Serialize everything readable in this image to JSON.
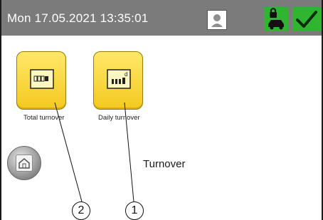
{
  "header": {
    "datetime": "Mon 17.05.2021  13:35:01",
    "user_icon": "user-icon",
    "lock_icon": "lock-car-icon",
    "check_icon": "checkmark-icon"
  },
  "tiles": [
    {
      "label": "Total turnover",
      "icon": "odometer-total-icon"
    },
    {
      "label": "Daily turnover",
      "icon": "odometer-daily-icon"
    }
  ],
  "tiles_daily_superscript": "d",
  "home_icon": "home-icon",
  "screen_title": "Turnover",
  "callouts": [
    "2",
    "1"
  ],
  "colors": {
    "header": "#7b7b7b",
    "accent_green": "#2fb52f",
    "tile_yellow": "#f4c91f"
  }
}
